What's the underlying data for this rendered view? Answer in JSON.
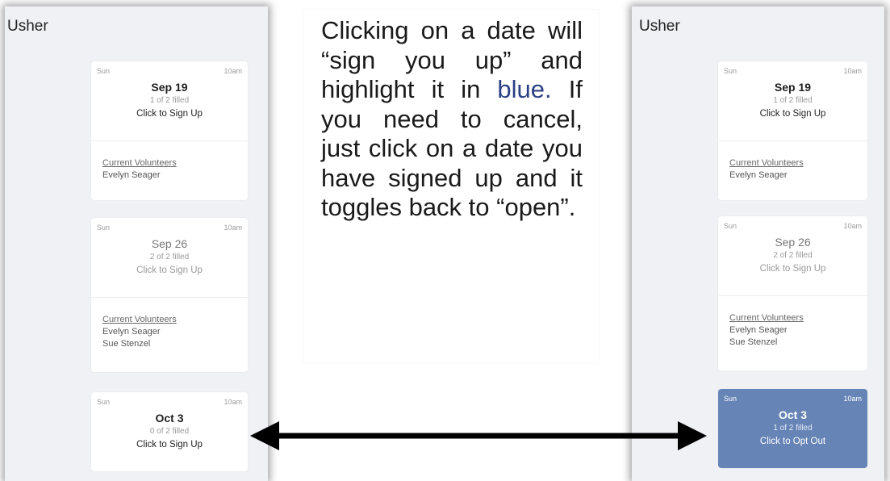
{
  "left_panel": {
    "title": "Usher",
    "cards": [
      {
        "day": "Sun",
        "time": "10am",
        "date": "Sep 19",
        "filled": "1 of 2 filled",
        "action": "Click to Sign Up",
        "volunteers_label": "Current Volunteers",
        "volunteers": [
          "Evelyn Seager"
        ]
      },
      {
        "day": "Sun",
        "time": "10am",
        "date": "Sep 26",
        "filled": "2 of 2 filled",
        "action": "Click to Sign Up",
        "volunteers_label": "Current Volunteers",
        "volunteers": [
          "Evelyn Seager",
          "Sue Stenzel"
        ]
      },
      {
        "day": "Sun",
        "time": "10am",
        "date": "Oct 3",
        "filled": "0 of 2 filled",
        "action": "Click to Sign Up"
      }
    ]
  },
  "right_panel": {
    "title": "Usher",
    "cards": [
      {
        "day": "Sun",
        "time": "10am",
        "date": "Sep 19",
        "filled": "1 of 2 filled",
        "action": "Click to Sign Up",
        "volunteers_label": "Current Volunteers",
        "volunteers": [
          "Evelyn Seager"
        ]
      },
      {
        "day": "Sun",
        "time": "10am",
        "date": "Sep 26",
        "filled": "2 of 2 filled",
        "action": "Click to Sign Up",
        "volunteers_label": "Current Volunteers",
        "volunteers": [
          "Evelyn Seager",
          "Sue Stenzel"
        ]
      },
      {
        "day": "Sun",
        "time": "10am",
        "date": "Oct 3",
        "filled": "1 of 2 filled",
        "action": "Click to Opt Out"
      }
    ]
  },
  "explanation": {
    "part1": "Clicking on a date will “sign you up” and highlight it in ",
    "highlight": "blue.",
    "part2": " If you need to cancel, just click on a date you have signed up and it toggles back to “open”."
  },
  "colors": {
    "selected": "#6684b6",
    "highlight_text": "#2b3f85",
    "panel_bg": "#eff1f5"
  },
  "icons": {
    "arrow": "double-headed-arrow"
  }
}
